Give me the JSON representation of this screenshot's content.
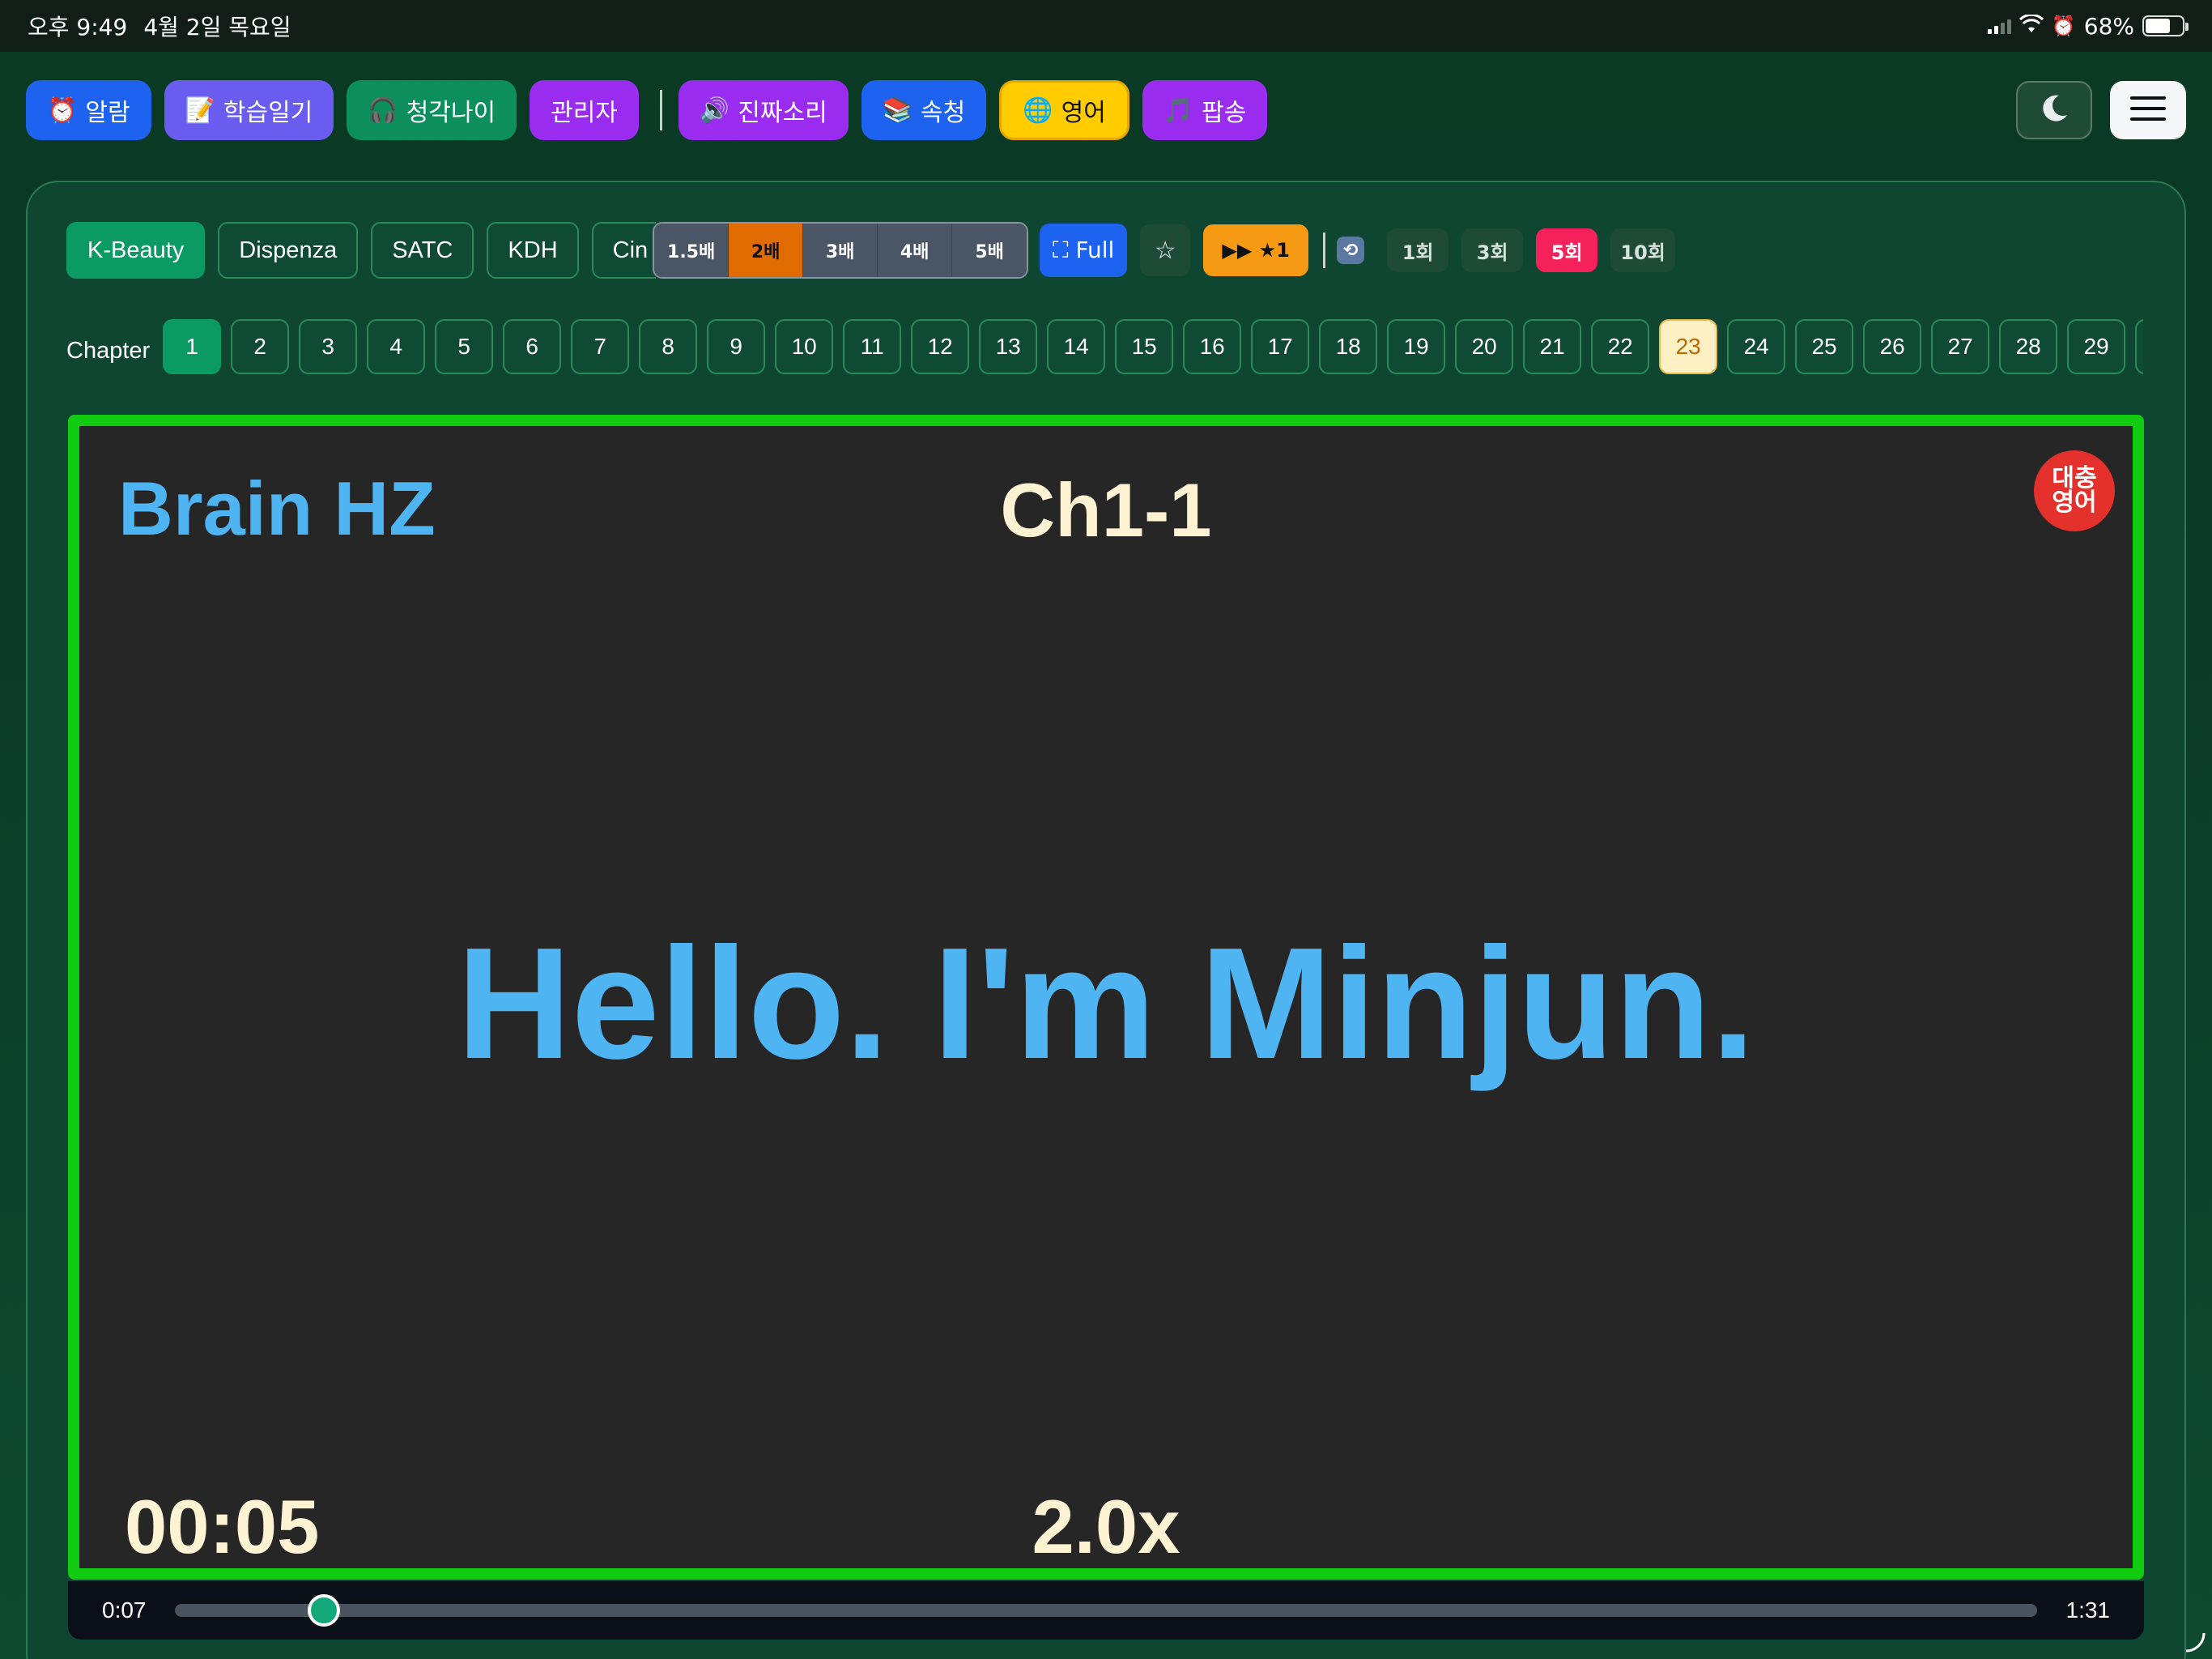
{
  "status": {
    "time": "오후 9:49",
    "date": "4월 2일 목요일",
    "battery": "68%",
    "battery_level": 0.68
  },
  "nav": {
    "buttons": [
      {
        "icon": "⏰",
        "label": "알람",
        "color": "#1d63f0"
      },
      {
        "icon": "📝",
        "label": "학습일기",
        "color": "#6b5cf0"
      },
      {
        "icon": "🎧",
        "label": "청각나이",
        "color": "#0c8f5c"
      },
      {
        "icon": "",
        "label": "관리자",
        "color": "#9a2cf0"
      }
    ],
    "buttons2": [
      {
        "icon": "🔊",
        "label": "진짜소리",
        "color": "#9a2cf0"
      },
      {
        "icon": "📚",
        "label": "속청",
        "color": "#1d63f0"
      },
      {
        "icon": "🌐",
        "label": "영어",
        "color": "#ffcc00"
      },
      {
        "icon": "🎵",
        "label": "팝송",
        "color": "#9a2cf0"
      }
    ]
  },
  "tags": [
    "K-Beauty",
    "Dispenza",
    "SATC",
    "KDH",
    "Cin"
  ],
  "speeds": [
    "1.5배",
    "2배",
    "3배",
    "4배",
    "5배"
  ],
  "full_label": "⛶ Full",
  "star_label": "☆",
  "ffwd_label": "▶▶ ★1",
  "repeat_counts": [
    "1회",
    "3회",
    "5회",
    "10회"
  ],
  "chapter_label": "Chapter",
  "chapters": [
    "1",
    "2",
    "3",
    "4",
    "5",
    "6",
    "7",
    "8",
    "9",
    "10",
    "11",
    "12",
    "13",
    "14",
    "15",
    "16",
    "17",
    "18",
    "19",
    "20",
    "21",
    "22",
    "23",
    "24",
    "25",
    "26",
    "27",
    "28",
    "29"
  ],
  "video": {
    "brand": "Brain HZ",
    "chapter_title": "Ch1-1",
    "logo_text": "대충\n영어",
    "caption": "Hello. I'm Minjun.",
    "timer": "00:05",
    "rate": "2.0x"
  },
  "progress": {
    "current": "0:07",
    "total": "1:31",
    "fraction": 0.08
  },
  "colors": {
    "accent_green": "#12cc12",
    "caption_blue": "#4eb4f2"
  }
}
